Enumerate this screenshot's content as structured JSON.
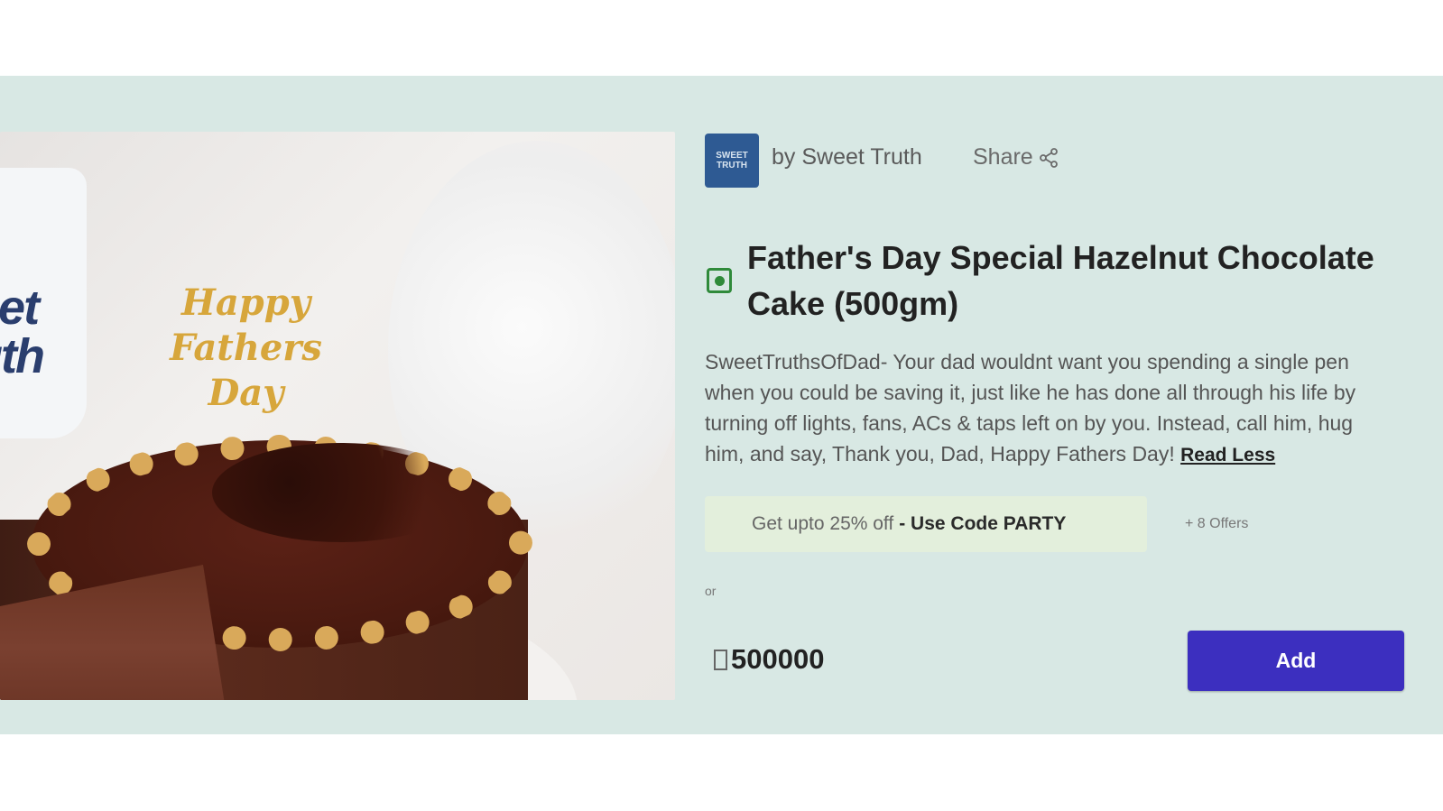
{
  "vendor": {
    "logo_text": "SWEET TRUTH",
    "name": "by Sweet Truth",
    "share_label": "Share"
  },
  "product": {
    "image_topper_text": "Happy Fathers Day",
    "mug_text": "eet\nuth",
    "veg": true,
    "title_line1": "Father's Day Special Hazelnut Chocolate",
    "title_line2": "Cake (500gm)",
    "description_lines": [
      "SweetTruthsOfDad- Your dad wouldnt want you spending a single pen",
      "when you could be saving it, just like he has done all through his life by",
      "turning off lights, fans, ACs & taps left on by you. Instead, call him, hug",
      "him, and say, Thank you, Dad, Happy Fathers Day!"
    ],
    "read_less_label": "Read Less"
  },
  "offers": {
    "text": "Get upto 25% off",
    "code": "- Use Code PARTY",
    "more": "+ 8 Offers"
  },
  "or_label": "or",
  "price": {
    "amount": "500000"
  },
  "add_label": "Add",
  "colors": {
    "band": "#d8e8e4",
    "add_button": "#3c2fbf",
    "veg_green": "#2f8a3a",
    "offer_bg": "#e3efdc"
  }
}
